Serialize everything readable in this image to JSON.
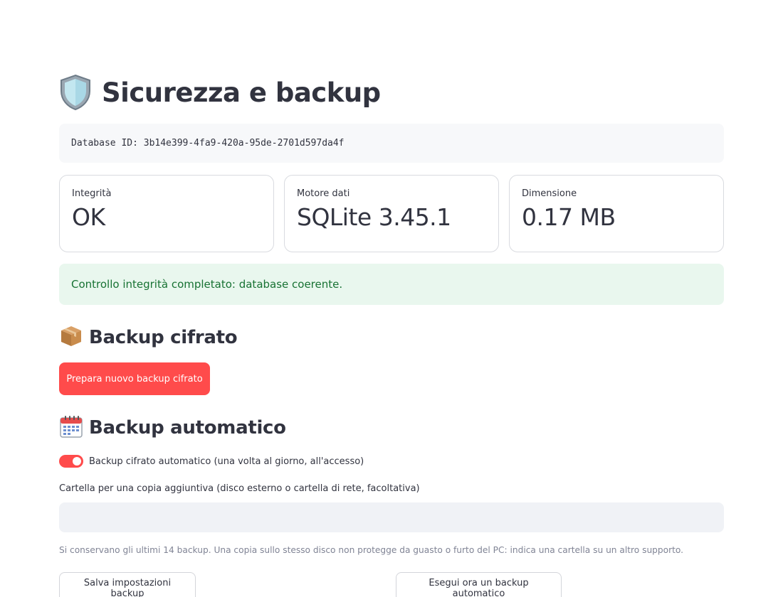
{
  "page": {
    "title": "Sicurezza e backup",
    "title_icon": "shield-icon"
  },
  "database": {
    "id_text": "Database ID: 3b14e399-4fa9-420a-95de-2701d597da4f"
  },
  "metrics": [
    {
      "label": "Integrità",
      "value": "OK"
    },
    {
      "label": "Motore dati",
      "value": "SQLite 3.45.1"
    },
    {
      "label": "Dimensione",
      "value": "0.17 MB"
    }
  ],
  "integrity_alert": {
    "text": "Controllo integrità completato: database coerente."
  },
  "encrypted_backup": {
    "heading": "Backup cifrato",
    "icon": "package-icon",
    "button_label": "Prepara nuovo backup cifrato"
  },
  "auto_backup": {
    "heading": "Backup automatico",
    "icon": "calendar-icon",
    "toggle_label": "Backup cifrato automatico (una volta al giorno, all'accesso)",
    "toggle_on": true,
    "folder_label": "Cartella per una copia aggiuntiva (disco esterno o cartella di rete, facoltativa)",
    "folder_value": "",
    "caption": "Si conservano gli ultimi 14 backup. Una copia sullo stesso disco non protegge da guasto o furto del PC: indica una cartella su un altro supporto.",
    "save_button": "Salva impostazioni backup",
    "run_button": "Esegui ora un backup automatico"
  },
  "colors": {
    "primary": "#ff4b4b",
    "success_bg": "#e9f7ee",
    "success_text": "#177233"
  }
}
